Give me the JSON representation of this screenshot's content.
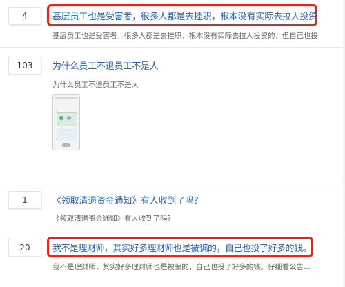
{
  "posts": [
    {
      "count": "4",
      "title": "基层员工也是受害者，很多人都是去挂职，根本没有实际去拉人投资",
      "excerpt": "基层员工也是受害者，很多人都是去挂职，根本没有实际去拉人投资的，但自己也投",
      "highlighted": true
    },
    {
      "count": "103",
      "title": "为什么员工不退员工不是人",
      "excerpt": "为什么员工不退员工不是人",
      "has_image": true
    },
    {
      "count": "1",
      "title": "《领取清退资金通知》有人收到了吗?",
      "excerpt": "《领取清退资金通知》有人收到了吗?"
    },
    {
      "count": "20",
      "title": "我不是理财师，其实好多理财师也是被骗的，自己也投了好多的钱。",
      "excerpt": "我不是理财师，其实好多理财师也是被骗的，自己也投了好多的钱。仔细看公告...",
      "highlighted": true
    }
  ],
  "colors": {
    "title": "#2d64b3",
    "highlight": "#e4241a",
    "excerpt": "#666666"
  },
  "icons": {
    "thumbnail": "phone-screenshot-thumbnail"
  }
}
